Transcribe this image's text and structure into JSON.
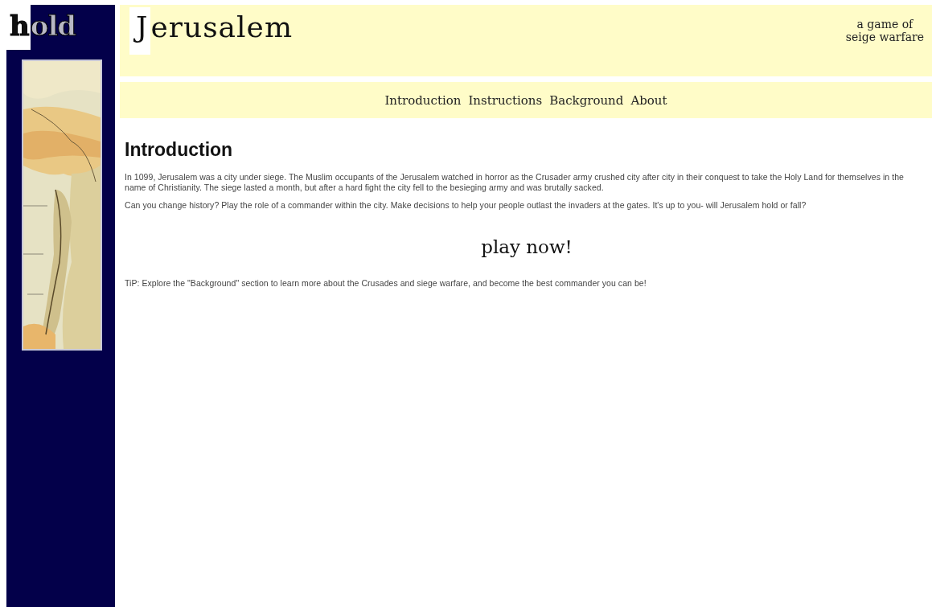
{
  "logo": {
    "text": "hold"
  },
  "header": {
    "title": "Jerusalem",
    "tagline": [
      "a game of",
      "seige warfare"
    ]
  },
  "nav": [
    {
      "label": "Introduction"
    },
    {
      "label": "Instructions"
    },
    {
      "label": "Background"
    },
    {
      "label": "About"
    }
  ],
  "content": {
    "heading": "Introduction",
    "paragraphs": [
      "In 1099, Jerusalem was a city under siege. The Muslim occupants of the Jerusalem watched in horror as the Crusader army crushed city after city in their conquest to take the Holy Land for themselves in the name of Christianity. The siege lasted a month, but after a hard fight the city fell to the besieging army and was brutally sacked.",
      "Can you change history? Play the role of a commander within the city. Make decisions to help your people outlast the invaders at the gates. It's up to you- will Jerusalem hold or fall?"
    ],
    "play_link": "play now!",
    "tip": "TiP: Explore the \"Background\" section to learn more about the Crusades and siege warfare, and become the best commander you can be!"
  }
}
